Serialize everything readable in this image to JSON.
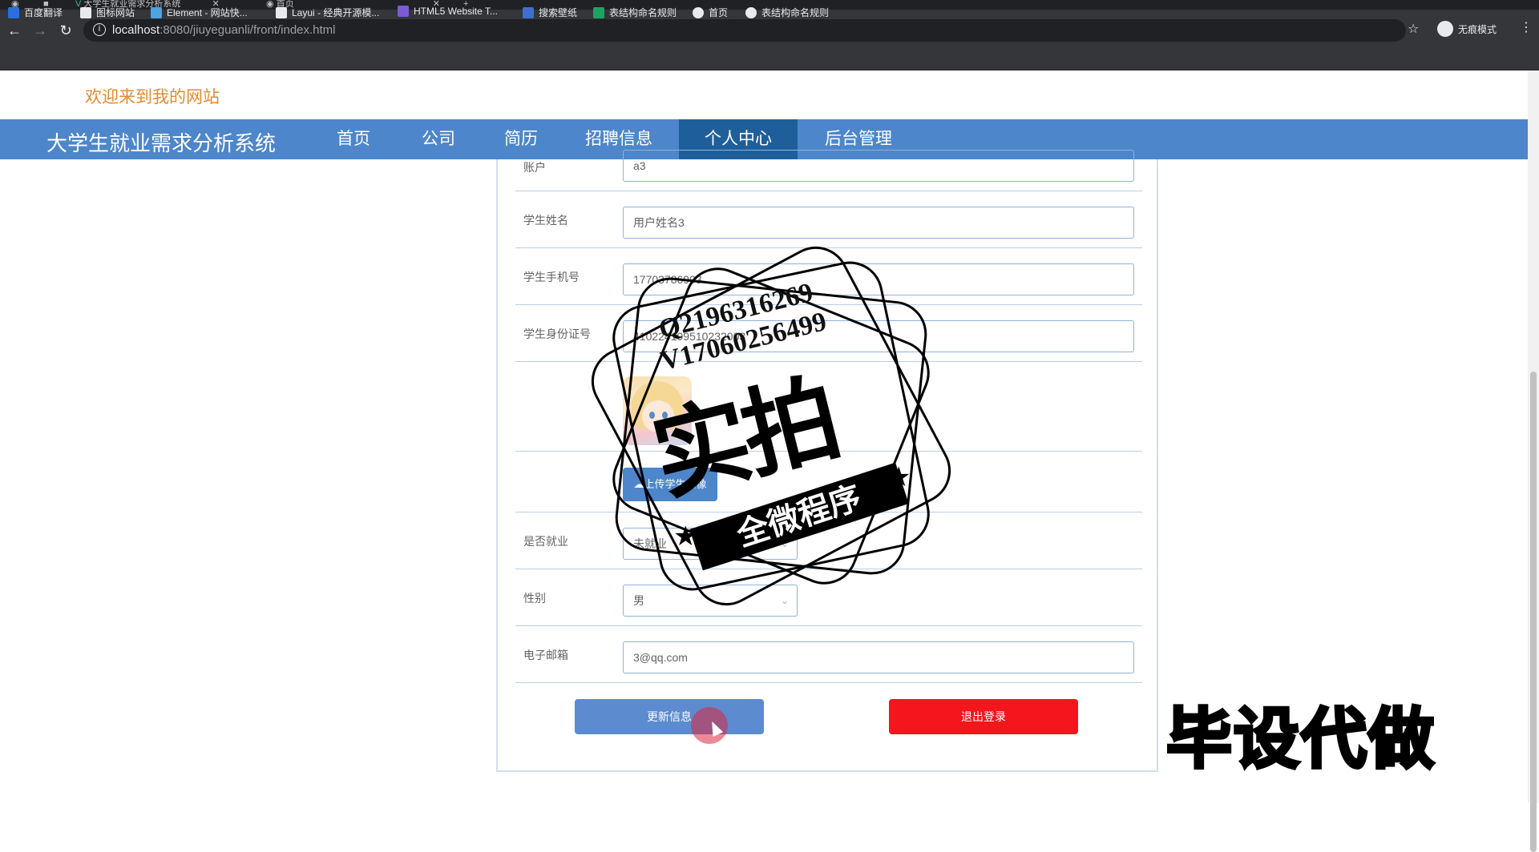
{
  "browser": {
    "tabs": [
      {
        "title": "大学生就业需求分析系统",
        "icon": "vue-icon"
      },
      {
        "title": "首页",
        "icon": "globe-icon"
      }
    ],
    "new_tab": "+",
    "url_host": "localhost",
    "url_path": ":8080/jiuyeguanli/front/index.html",
    "incognito_label": "无痕模式",
    "bookmarks": [
      {
        "label": "百度翻译",
        "color": "#2a6fe0"
      },
      {
        "label": "图标网站",
        "color": "#e8eaed"
      },
      {
        "label": "Element - 网站快...",
        "color": "#4fa3e0"
      },
      {
        "label": "Layui - 经典开源模...",
        "color": "#e8eaed"
      },
      {
        "label": "HTML5 Website T...",
        "color": "#7b5cd6"
      },
      {
        "label": "搜索壁纸",
        "color": "#3c6fd0"
      },
      {
        "label": "表结构命名规则",
        "color": "#1da462"
      },
      {
        "label": "首页",
        "color": "#e8eaed"
      },
      {
        "label": "表结构命名规则",
        "color": "#e8eaed"
      }
    ]
  },
  "page": {
    "welcome": "欢迎来到我的网站",
    "brand": "大学生就业需求分析系统",
    "nav": [
      "首页",
      "公司",
      "简历",
      "招聘信息",
      "个人中心",
      "后台管理"
    ],
    "nav_active": "个人中心"
  },
  "form": {
    "account_label": "账户",
    "account_value": "a3",
    "name_label": "学生姓名",
    "name_value": "用户姓名3",
    "phone_label": "学生手机号",
    "phone_value": "17703786903",
    "id_label": "学生身份证号",
    "id_value": "410224199510232003",
    "upload_label": "上传学生头像",
    "employed_label": "是否就业",
    "employed_value": "未就业",
    "gender_label": "性别",
    "gender_value": "男",
    "email_label": "电子邮箱",
    "email_value": "3@qq.com",
    "update_button": "更新信息",
    "logout_button": "退出登录"
  },
  "overlay": {
    "stamp_line1": "Q2196316269",
    "stamp_line2": "V17060256499",
    "stamp_big": "实拍",
    "stamp_ribbon": "全微程序",
    "corner_text": "毕设代做"
  },
  "colors": {
    "nav_bg": "#4d86cb",
    "nav_active": "#1e5f9b",
    "welcome": "#e58a2c",
    "logout": "#f5151c",
    "update": "#5c8bd0"
  }
}
